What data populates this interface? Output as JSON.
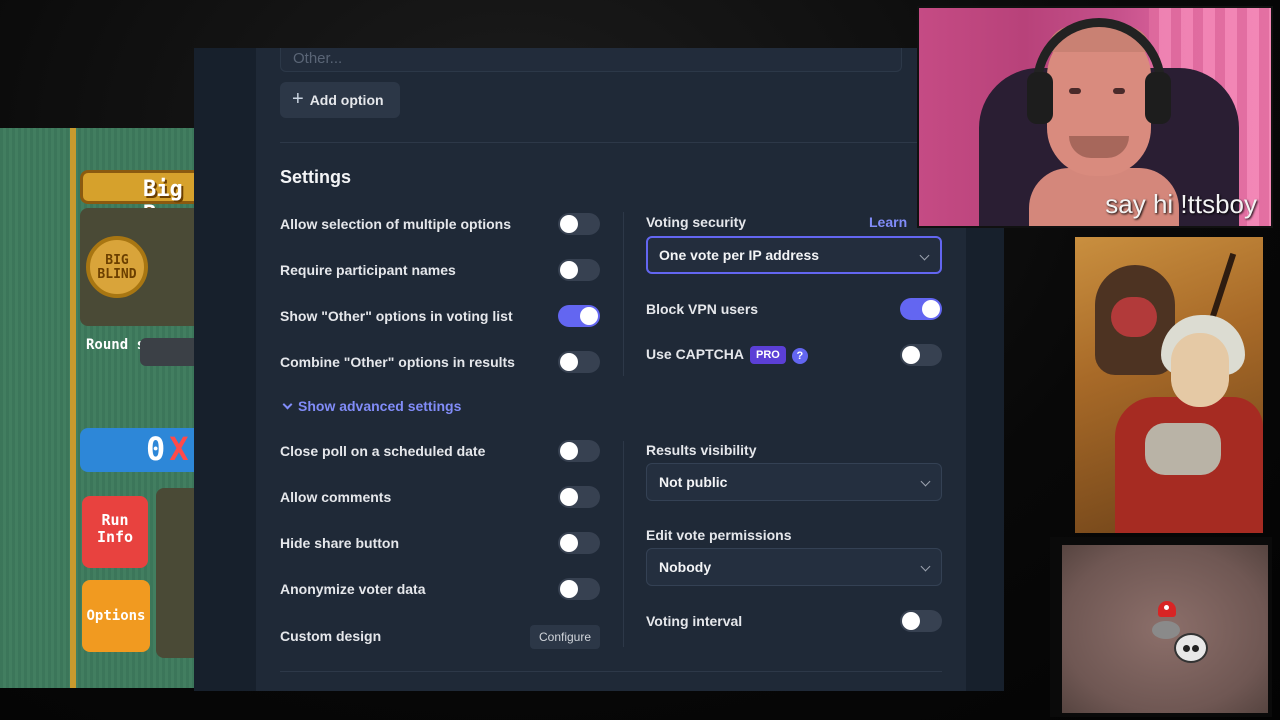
{
  "game": {
    "blind_title": "Big B",
    "chip_label": "BIG BLIND",
    "round_score_label": "Round score",
    "chips_value": "0",
    "mult_symbol": "X",
    "run_info_label": "Run Info",
    "options_label": "Options"
  },
  "poll": {
    "other_placeholder": "Other...",
    "add_option_label": "Add option",
    "settings_title": "Settings",
    "left_settings": [
      {
        "label": "Allow selection of multiple options",
        "on": false
      },
      {
        "label": "Require participant names",
        "on": false
      },
      {
        "label": "Show \"Other\" options in voting list",
        "on": true
      },
      {
        "label": "Combine \"Other\" options in results",
        "on": false
      }
    ],
    "advanced_link": "Show advanced settings",
    "advanced_settings": [
      {
        "label": "Close poll on a scheduled date",
        "on": false
      },
      {
        "label": "Allow comments",
        "on": false
      },
      {
        "label": "Hide share button",
        "on": false
      },
      {
        "label": "Anonymize voter data",
        "on": false
      }
    ],
    "custom_design_label": "Custom design",
    "configure_label": "Configure",
    "voting_security": {
      "label": "Voting security",
      "learn_label": "Learn",
      "value": "One vote per IP address"
    },
    "block_vpn": {
      "label": "Block VPN users",
      "on": true
    },
    "captcha": {
      "label": "Use CAPTCHA",
      "badge": "PRO",
      "help": "?",
      "on": false
    },
    "results_visibility": {
      "label": "Results visibility",
      "value": "Not public"
    },
    "edit_vote_permissions": {
      "label": "Edit vote permissions",
      "value": "Nobody"
    },
    "voting_interval": {
      "label": "Voting interval",
      "on": false
    }
  },
  "webcam": {
    "caption": "say hi !ttsboy"
  },
  "colors": {
    "accent": "#6366f1",
    "panel_bg": "#1f2937",
    "link": "#818cf8",
    "pro_badge": "#5b3fd6"
  }
}
